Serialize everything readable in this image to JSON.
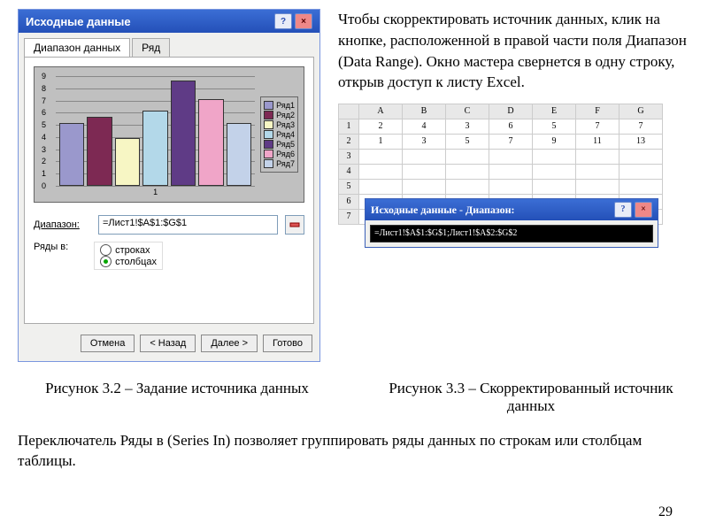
{
  "dialog1": {
    "title": "Исходные данные",
    "tabs": [
      "Диапазон данных",
      "Ряд"
    ],
    "range_label": "Диапазон:",
    "range_value": "=Лист1!$A$1:$G$1",
    "series_label": "Ряды в:",
    "radio_rows": "строках",
    "radio_cols": "столбцах",
    "buttons": {
      "cancel": "Отмена",
      "back": "< Назад",
      "next": "Далее >",
      "finish": "Готово"
    }
  },
  "chart_data": {
    "type": "bar",
    "categories": [
      "1"
    ],
    "series": [
      {
        "name": "Ряд1",
        "value": 5.0,
        "color": "#9a98cc"
      },
      {
        "name": "Ряд2",
        "value": 5.5,
        "color": "#7d2953"
      },
      {
        "name": "Ряд3",
        "value": 3.8,
        "color": "#f7f6c4"
      },
      {
        "name": "Ряд4",
        "value": 6.0,
        "color": "#b3d8e9"
      },
      {
        "name": "Ряд5",
        "value": 8.5,
        "color": "#5f3b86"
      },
      {
        "name": "Ряд6",
        "value": 7.0,
        "color": "#f0a5c8"
      },
      {
        "name": "Ряд7",
        "value": 5.0,
        "color": "#c3d2e9"
      }
    ],
    "ylim": [
      0,
      9
    ],
    "yticks": [
      0,
      1,
      2,
      3,
      4,
      5,
      6,
      7,
      8,
      9
    ],
    "xlabel": "1"
  },
  "paragraph_right": "Чтобы скорректировать источник данных, клик на кнопке, расположенной в правой части поля Диапазон (Data Range). Окно мастера свернется в одну строку, открыв доступ к листу Excel.",
  "sheet": {
    "cols": [
      "A",
      "B",
      "C",
      "D",
      "E",
      "F",
      "G"
    ],
    "rows": [
      {
        "h": "1",
        "cells": [
          "2",
          "4",
          "3",
          "6",
          "5",
          "7",
          "7"
        ]
      },
      {
        "h": "2",
        "cells": [
          "1",
          "3",
          "5",
          "7",
          "9",
          "11",
          "13"
        ]
      },
      {
        "h": "3",
        "cells": [
          "",
          "",
          "",
          "",
          "",
          "",
          ""
        ]
      },
      {
        "h": "4",
        "cells": [
          "",
          "",
          "",
          "",
          "",
          "",
          ""
        ]
      },
      {
        "h": "5",
        "cells": [
          "",
          "",
          "",
          "",
          "",
          "",
          ""
        ]
      },
      {
        "h": "6",
        "cells": [
          "",
          "",
          "",
          "",
          "",
          "",
          ""
        ]
      },
      {
        "h": "7",
        "cells": [
          "",
          "",
          "",
          "",
          "",
          "",
          ""
        ]
      }
    ]
  },
  "minidlg": {
    "title": "Исходные данные - Диапазон:",
    "value": "=Лист1!$A$1:$G$1;Лист1!$A$2:$G$2"
  },
  "captions": {
    "left": "Рисунок 3.2 – Задание источника данных",
    "right": "Рисунок 3.3 – Скорректированный источник данных"
  },
  "bottom_text": "Переключатель Ряды в (Series In) позволяет группировать ряды данных по строкам или столбцам таблицы.",
  "page_number": "29"
}
